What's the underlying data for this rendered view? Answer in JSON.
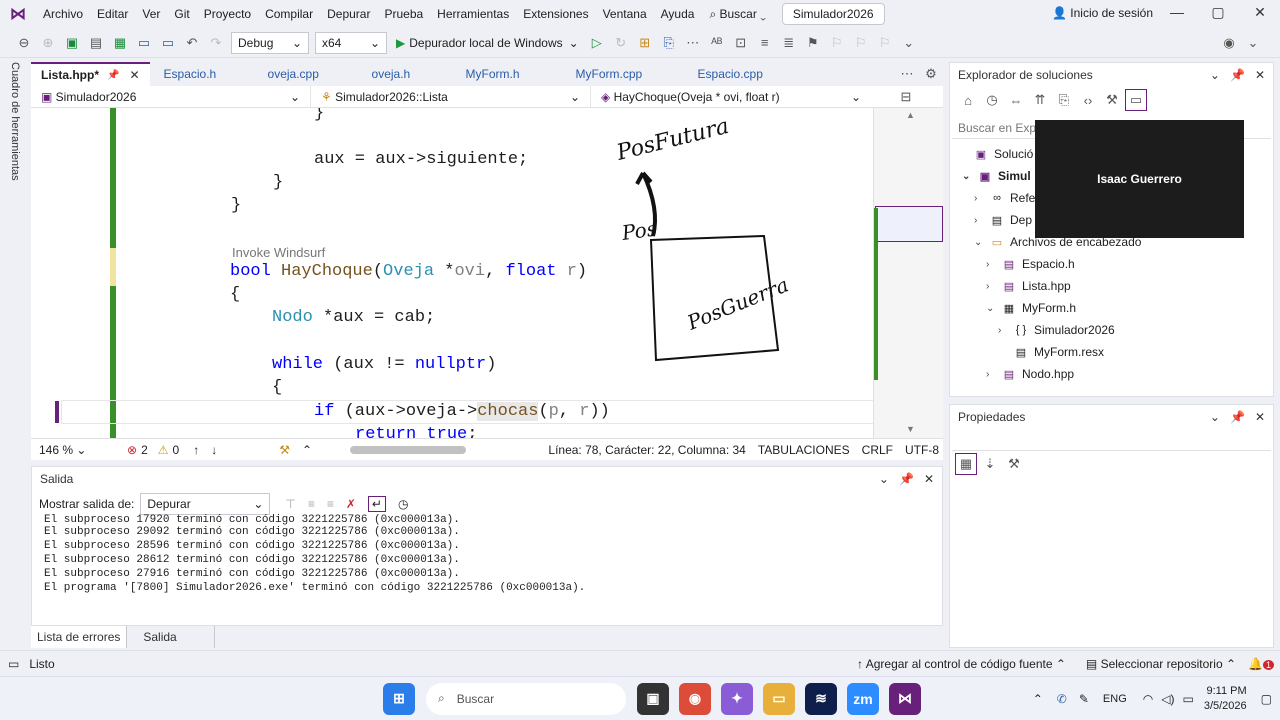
{
  "menu": {
    "items": [
      "Archivo",
      "Editar",
      "Ver",
      "Git",
      "Proyecto",
      "Compilar",
      "Depurar",
      "Prueba",
      "Herramientas",
      "Extensiones",
      "Ventana",
      "Ayuda"
    ],
    "search": "Buscar",
    "project": "Simulador2026",
    "login": "Inicio de sesión"
  },
  "toolbar": {
    "config": "Debug",
    "platform": "x64",
    "run": "Depurador local de Windows"
  },
  "left_tool": "Cuadro de herramientas",
  "tabs": [
    {
      "label": "Lista.hpp*"
    },
    {
      "label": "Espacio.h"
    },
    {
      "label": "oveja.cpp"
    },
    {
      "label": "oveja.h"
    },
    {
      "label": "MyForm.h"
    },
    {
      "label": "MyForm.cpp"
    },
    {
      "label": "Espacio.cpp"
    }
  ],
  "nav": {
    "project": "Simulador2026",
    "scope": "Simulador2026::Lista",
    "member": "HayChoque(Oveja * ovi, float r)"
  },
  "code": {
    "codelens": "Invoke Windsurf"
  },
  "drawing": {
    "label1": "PosFutura",
    "label2": "Pos",
    "label3": "PosGuerra"
  },
  "status": {
    "zoom": "146 %",
    "errors": "2",
    "warnings": "0",
    "position": "Línea: 78, Carácter: 22, Columna: 34",
    "indent": "TABULACIONES",
    "eol": "CRLF",
    "encoding": "UTF-8"
  },
  "output": {
    "title": "Salida",
    "show_label": "Mostrar salida de:",
    "source": "Depurar",
    "lines": [
      "El subproceso 17920 terminó con código 3221225786 (0xc000013a).",
      "El subproceso 29092 terminó con código 3221225786 (0xc000013a).",
      "El subproceso 28596 terminó con código 3221225786 (0xc000013a).",
      "El subproceso 28612 terminó con código 3221225786 (0xc000013a).",
      "El subproceso 27916 terminó con código 3221225786 (0xc000013a).",
      "El programa '[7800] Simulador2026.exe' terminó con código 3221225786 (0xc000013a)."
    ]
  },
  "bottom_tabs": [
    "Lista de errores",
    "Salida"
  ],
  "solution": {
    "title": "Explorador de soluciones",
    "search_placeholder": "Buscar en Explo",
    "items": [
      "Solució",
      "Simul",
      "Refe",
      "Dep",
      "Archivos de encabezado",
      "Espacio.h",
      "Lista.hpp",
      "MyForm.h",
      "Simulador2026",
      "MyForm.resx",
      "Nodo.hpp"
    ]
  },
  "video": {
    "name": "Isaac Guerrero"
  },
  "properties": {
    "title": "Propiedades"
  },
  "statusbar": {
    "ready": "Listo",
    "source_control": "Agregar al control de código fuente",
    "repo": "Seleccionar repositorio",
    "badge": "1"
  },
  "taskbar": {
    "search": "Buscar",
    "lang": "ENG",
    "time": "9:11 PM",
    "date": "3/5/2026"
  }
}
